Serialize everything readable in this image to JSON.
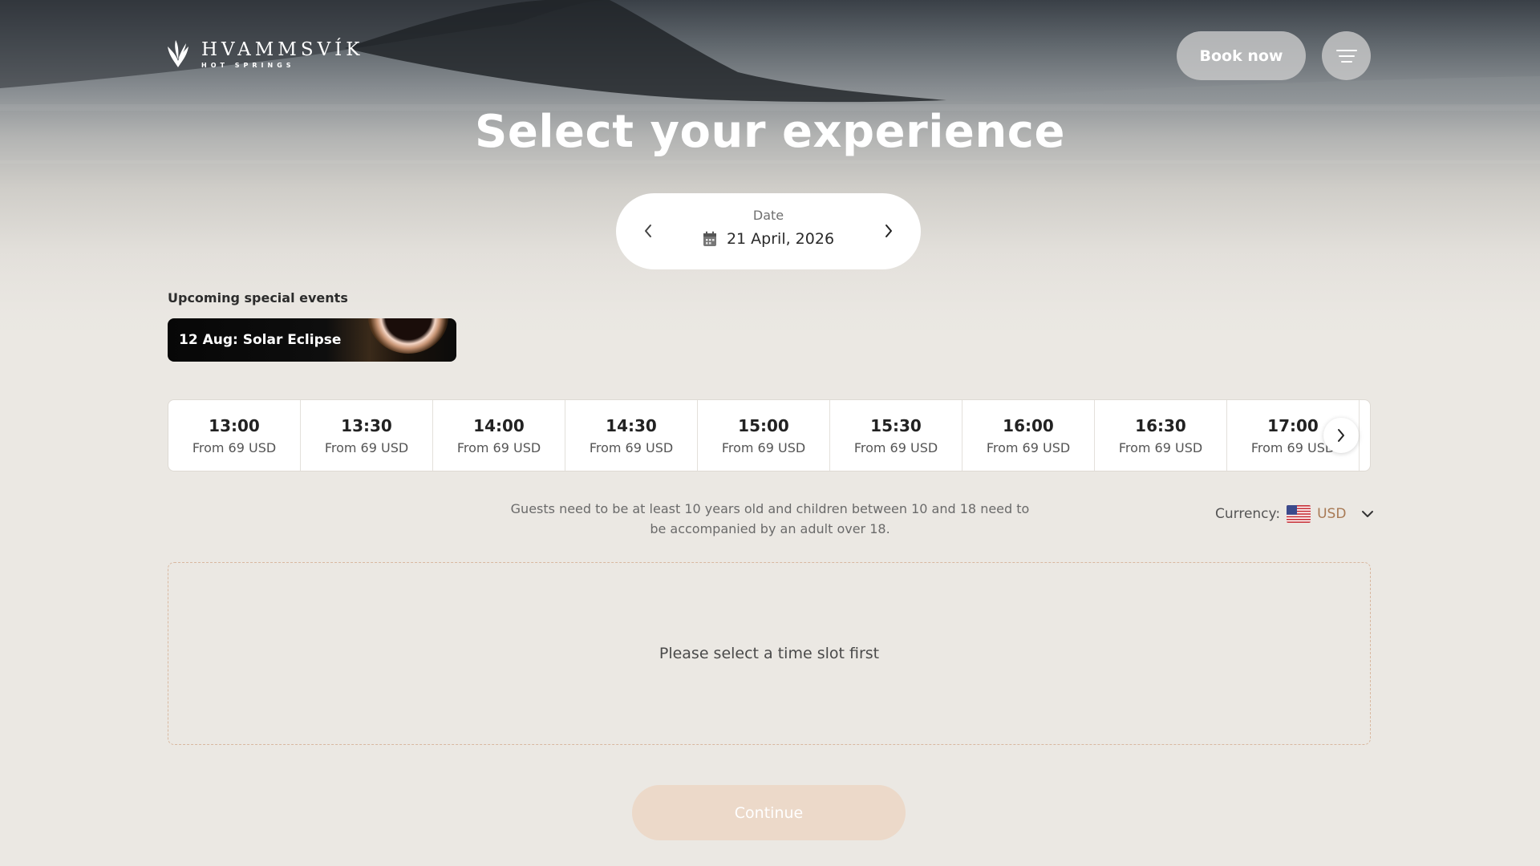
{
  "brand": {
    "name": "HVAMMSVÍK",
    "subtitle": "HOT SPRINGS"
  },
  "header": {
    "book_now_label": "Book now"
  },
  "page_title": "Select your experience",
  "date_picker": {
    "label": "Date",
    "value": "21 April, 2026"
  },
  "events": {
    "heading": "Upcoming special events",
    "items": [
      {
        "label": "12 Aug: Solar Eclipse"
      }
    ]
  },
  "time_slots": [
    {
      "time": "13:00",
      "price": "From 69 USD"
    },
    {
      "time": "13:30",
      "price": "From 69 USD"
    },
    {
      "time": "14:00",
      "price": "From 69 USD"
    },
    {
      "time": "14:30",
      "price": "From 69 USD"
    },
    {
      "time": "15:00",
      "price": "From 69 USD"
    },
    {
      "time": "15:30",
      "price": "From 69 USD"
    },
    {
      "time": "16:00",
      "price": "From 69 USD"
    },
    {
      "time": "16:30",
      "price": "From 69 USD"
    },
    {
      "time": "17:00",
      "price": "From 69 USD"
    }
  ],
  "notice": "Guests need to be at least 10 years old and children between 10 and 18 need to be accompanied by an adult over 18.",
  "currency": {
    "label": "Currency:",
    "value": "USD",
    "flag_icon": "us-flag-icon"
  },
  "empty_state": "Please select a time slot first",
  "continue_label": "Continue",
  "colors": {
    "background": "#ebe8e3",
    "accent": "#a87a55",
    "continue_disabled": "#ecd9c9",
    "dashed_border": "#d9b8a0"
  }
}
